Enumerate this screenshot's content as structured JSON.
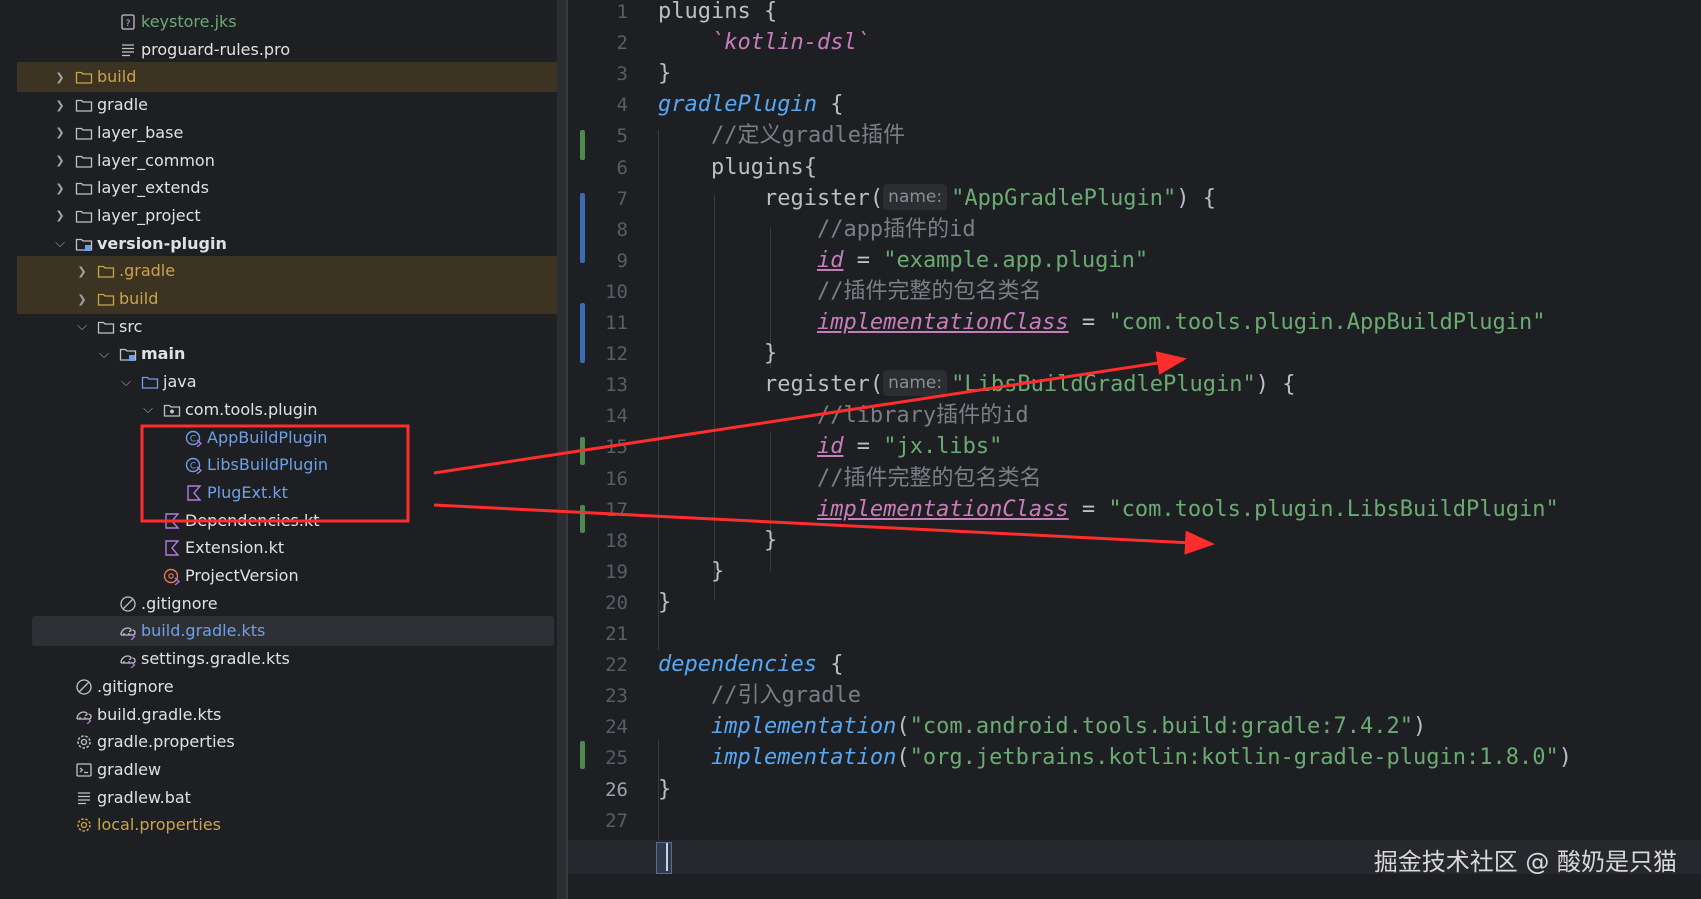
{
  "tree": {
    "items": [
      {
        "label": "keystore.jks",
        "icon": "keystore-icon",
        "color": "green"
      },
      {
        "label": "proguard-rules.pro",
        "icon": "text-file-icon",
        "color": "default"
      },
      {
        "label": "build",
        "icon": "folder-icon",
        "color": "orange",
        "chevron": "right",
        "highlight": true
      },
      {
        "label": "gradle",
        "icon": "folder-icon",
        "color": "default",
        "chevron": "right"
      },
      {
        "label": "layer_base",
        "icon": "folder-icon",
        "color": "default",
        "chevron": "right"
      },
      {
        "label": "layer_common",
        "icon": "folder-icon",
        "color": "default",
        "chevron": "right"
      },
      {
        "label": "layer_extends",
        "icon": "folder-icon",
        "color": "default",
        "chevron": "right"
      },
      {
        "label": "layer_project",
        "icon": "folder-icon",
        "color": "default",
        "chevron": "right"
      },
      {
        "label": "version-plugin",
        "icon": "module-folder-icon",
        "color": "default",
        "chevron": "down",
        "bold": true
      },
      {
        "label": ".gradle",
        "icon": "folder-icon",
        "color": "orange",
        "chevron": "right",
        "highlight": true
      },
      {
        "label": "build",
        "icon": "folder-icon",
        "color": "orange",
        "chevron": "right",
        "highlight": true
      },
      {
        "label": "src",
        "icon": "folder-icon",
        "color": "default",
        "chevron": "down"
      },
      {
        "label": "main",
        "icon": "source-folder-icon",
        "color": "default",
        "chevron": "down",
        "bold": true
      },
      {
        "label": "java",
        "icon": "java-folder-icon",
        "color": "default",
        "chevron": "down"
      },
      {
        "label": "com.tools.plugin",
        "icon": "package-icon",
        "color": "default",
        "chevron": "down"
      },
      {
        "label": "AppBuildPlugin",
        "icon": "kotlin-class-icon",
        "color": "blue"
      },
      {
        "label": "LibsBuildPlugin",
        "icon": "kotlin-class-icon",
        "color": "blue"
      },
      {
        "label": "PlugExt.kt",
        "icon": "kotlin-file-icon",
        "color": "blue"
      },
      {
        "label": "Dependencies.kt",
        "icon": "kotlin-file-icon",
        "color": "default"
      },
      {
        "label": "Extension.kt",
        "icon": "kotlin-file-icon",
        "color": "default"
      },
      {
        "label": "ProjectVersion",
        "icon": "kotlin-object-icon",
        "color": "default"
      },
      {
        "label": ".gitignore",
        "icon": "ignore-file-icon",
        "color": "default"
      },
      {
        "label": "build.gradle.kts",
        "icon": "gradle-icon",
        "color": "blue",
        "selected": true
      },
      {
        "label": "settings.gradle.kts",
        "icon": "gradle-icon",
        "color": "default"
      },
      {
        "label": ".gitignore",
        "icon": "ignore-file-icon",
        "color": "default"
      },
      {
        "label": "build.gradle.kts",
        "icon": "gradle-icon",
        "color": "default"
      },
      {
        "label": "gradle.properties",
        "icon": "gear-icon",
        "color": "default"
      },
      {
        "label": "gradlew",
        "icon": "terminal-icon",
        "color": "default"
      },
      {
        "label": "gradlew.bat",
        "icon": "text-file-icon",
        "color": "default"
      },
      {
        "label": "local.properties",
        "icon": "gear-icon",
        "color": "orange"
      }
    ]
  },
  "editor": {
    "current_line": "26",
    "lines": [
      {
        "n": "1",
        "segs": [
          {
            "t": "plugins {"
          }
        ]
      },
      {
        "n": "2",
        "segs": [
          {
            "t": "    "
          },
          {
            "t": "`kotlin-dsl`",
            "c": "kw-purple"
          }
        ]
      },
      {
        "n": "3",
        "segs": [
          {
            "t": "}"
          }
        ]
      },
      {
        "n": "4",
        "segs": [
          {
            "t": "gradlePlugin",
            "c": "kw-blue"
          },
          {
            "t": " {"
          }
        ]
      },
      {
        "n": "5",
        "segs": [
          {
            "t": "    "
          },
          {
            "t": "//定义gradle插件",
            "c": "cmt"
          }
        ]
      },
      {
        "n": "6",
        "segs": [
          {
            "t": "    plugins{"
          }
        ]
      },
      {
        "n": "7",
        "segs": [
          {
            "t": "        register("
          },
          {
            "t": "name:",
            "c": "hint"
          },
          {
            "t": "\"AppGradlePlugin\"",
            "c": "kw-green"
          },
          {
            "t": ") {"
          }
        ]
      },
      {
        "n": "8",
        "segs": [
          {
            "t": "            "
          },
          {
            "t": "//app插件的id",
            "c": "cmt"
          }
        ]
      },
      {
        "n": "9",
        "segs": [
          {
            "t": "            "
          },
          {
            "t": "id",
            "c": "ident-u"
          },
          {
            "t": " = "
          },
          {
            "t": "\"example.app.plugin\"",
            "c": "kw-green"
          }
        ]
      },
      {
        "n": "10",
        "segs": [
          {
            "t": "            "
          },
          {
            "t": "//插件完整的包名类名",
            "c": "cmt"
          }
        ]
      },
      {
        "n": "11",
        "segs": [
          {
            "t": "            "
          },
          {
            "t": "implementationClass",
            "c": "ident-u"
          },
          {
            "t": " = "
          },
          {
            "t": "\"com.tools.plugin.AppBuildPlugin\"",
            "c": "kw-green"
          }
        ]
      },
      {
        "n": "12",
        "segs": [
          {
            "t": "        }"
          }
        ]
      },
      {
        "n": "13",
        "segs": [
          {
            "t": "        register("
          },
          {
            "t": "name:",
            "c": "hint"
          },
          {
            "t": "\"LibsBuildGradlePlugin\"",
            "c": "kw-green"
          },
          {
            "t": ") {"
          }
        ]
      },
      {
        "n": "14",
        "segs": [
          {
            "t": "            "
          },
          {
            "t": "//library插件的id",
            "c": "cmt"
          }
        ]
      },
      {
        "n": "15",
        "segs": [
          {
            "t": "            "
          },
          {
            "t": "id",
            "c": "ident-u"
          },
          {
            "t": " = "
          },
          {
            "t": "\"jx.libs\"",
            "c": "kw-green"
          }
        ]
      },
      {
        "n": "16",
        "segs": [
          {
            "t": "            "
          },
          {
            "t": "//插件完整的包名类名",
            "c": "cmt"
          }
        ]
      },
      {
        "n": "17",
        "segs": [
          {
            "t": "            "
          },
          {
            "t": "implementationClass",
            "c": "ident-u"
          },
          {
            "t": " = "
          },
          {
            "t": "\"com.tools.plugin.LibsBuildPlugin\"",
            "c": "kw-green"
          }
        ]
      },
      {
        "n": "18",
        "segs": [
          {
            "t": "        }"
          }
        ]
      },
      {
        "n": "19",
        "segs": [
          {
            "t": "    }"
          }
        ]
      },
      {
        "n": "20",
        "segs": [
          {
            "t": "}"
          }
        ]
      },
      {
        "n": "21",
        "segs": [
          {
            "t": ""
          }
        ]
      },
      {
        "n": "22",
        "segs": [
          {
            "t": "dependencies",
            "c": "kw-blue"
          },
          {
            "t": " {"
          }
        ]
      },
      {
        "n": "23",
        "segs": [
          {
            "t": "    "
          },
          {
            "t": "//引入gradle",
            "c": "cmt"
          }
        ]
      },
      {
        "n": "24",
        "segs": [
          {
            "t": "    "
          },
          {
            "t": "implementation",
            "c": "kw-blue"
          },
          {
            "t": "("
          },
          {
            "t": "\"com.android.tools.build:gradle:7.4.2\"",
            "c": "kw-green"
          },
          {
            "t": ")"
          }
        ]
      },
      {
        "n": "25",
        "segs": [
          {
            "t": "    "
          },
          {
            "t": "implementation",
            "c": "kw-blue"
          },
          {
            "t": "("
          },
          {
            "t": "\"org.jetbrains.kotlin:kotlin-gradle-plugin:1.8.0\"",
            "c": "kw-green"
          },
          {
            "t": ")"
          }
        ]
      },
      {
        "n": "26",
        "segs": [
          {
            "t": "}"
          }
        ]
      },
      {
        "n": "27",
        "segs": [
          {
            "t": ""
          }
        ]
      }
    ]
  },
  "watermark": "掘金技术社区 @ 酸奶是只猫",
  "annotation_color": "#ff2d2d"
}
